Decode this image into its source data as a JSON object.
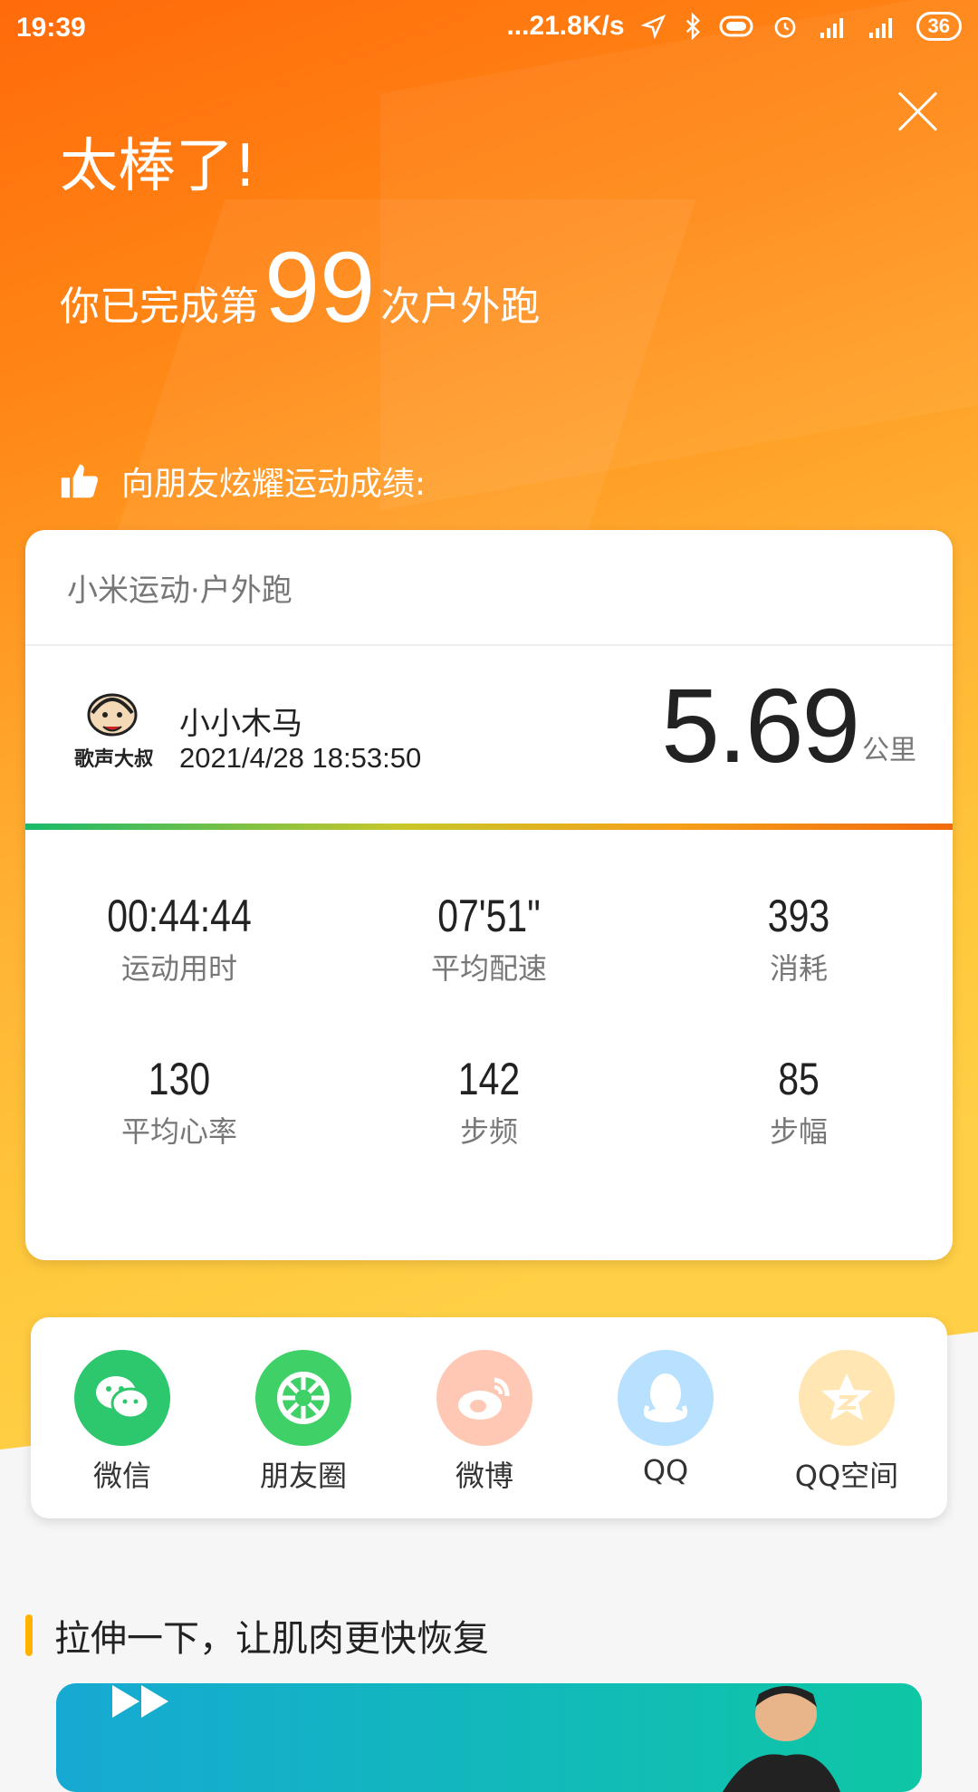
{
  "status_bar": {
    "time": "19:39",
    "network_speed": "...21.8K/s",
    "battery": "36"
  },
  "header": {
    "title": "太棒了!",
    "completed_prefix": "你已完成第",
    "completed_count": "99",
    "completed_suffix": "次户外跑",
    "brag_text": "向朋友炫耀运动成绩:"
  },
  "card": {
    "app_label": "小米运动·户外跑",
    "username": "小小木马",
    "datetime": "2021/4/28 18:53:50",
    "distance": "5.69",
    "distance_unit": "公里",
    "stats": [
      {
        "value": "00:44:44",
        "label": "运动用时"
      },
      {
        "value": "07'51\"",
        "label": "平均配速"
      },
      {
        "value": "393",
        "label": "消耗"
      },
      {
        "value": "130",
        "label": "平均心率"
      },
      {
        "value": "142",
        "label": "步频"
      },
      {
        "value": "85",
        "label": "步幅"
      }
    ]
  },
  "share": [
    {
      "label": "微信",
      "icon": "wechat-icon",
      "color": "#2dc76d"
    },
    {
      "label": "朋友圈",
      "icon": "moments-icon",
      "color": "#3fd168"
    },
    {
      "label": "微博",
      "icon": "weibo-icon",
      "color": "#ffc8b5"
    },
    {
      "label": "QQ",
      "icon": "qq-icon",
      "color": "#b7e1ff"
    },
    {
      "label": "QQ空间",
      "icon": "qzone-icon",
      "color": "#ffe6b3"
    }
  ],
  "section": {
    "title": "拉伸一下，让肌肉更快恢复"
  }
}
